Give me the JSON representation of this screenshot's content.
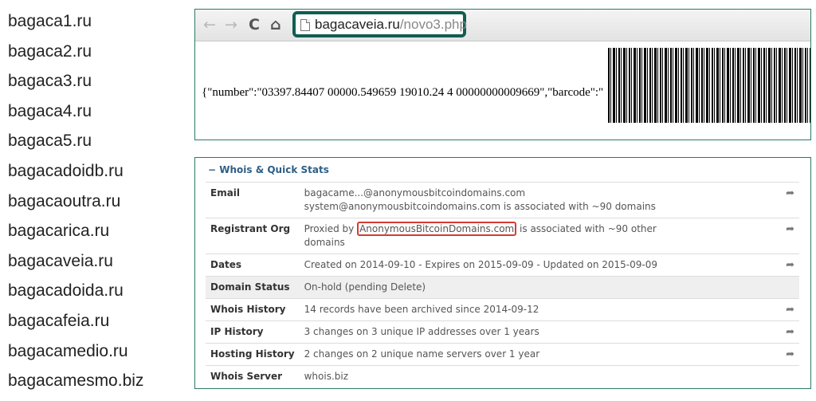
{
  "domains": [
    "bagaca1.ru",
    "bagaca2.ru",
    "bagaca3.ru",
    "bagaca4.ru",
    "bagaca5.ru",
    "bagacadoidb.ru",
    "bagacaoutra.ru",
    "bagacarica.ru",
    "bagacaveia.ru",
    "bagacadoida.ru",
    "bagacafeia.ru",
    "bagacamedio.ru",
    "bagacamesmo.biz"
  ],
  "browser": {
    "back_icon": "←",
    "forward_icon": "→",
    "reload_icon": "C",
    "home_icon": "⌂",
    "url_host": "bagacaveia.ru",
    "url_path": "/novo3.php",
    "content": "{\"number\":\"03397.84407 00000.549659 19010.24 4 00000000009669\",\"barcode\":\""
  },
  "whois": {
    "title": "Whois & Quick Stats",
    "rows": [
      {
        "key": "Email",
        "line1": "bagacame...@anonymousbitcoindomains.com",
        "line2": "system@anonymousbitcoindomains.com is associated with ~90 domains"
      },
      {
        "key": "Registrant Org",
        "pre": "Proxied by ",
        "highlight": "AnonymousBitcoinDomains.com",
        "post": " is associated with ~90 other",
        "line2": "domains"
      },
      {
        "key": "Dates",
        "value": "Created on 2014-09-10 - Expires on 2015-09-09 - Updated on 2015-09-09"
      },
      {
        "key": "Domain Status",
        "value": "On-hold (pending Delete)"
      },
      {
        "key": "Whois History",
        "value": "14 records have been archived since 2014-09-12"
      },
      {
        "key": "IP History",
        "value": "3 changes on 3 unique IP addresses over 1 years"
      },
      {
        "key": "Hosting History",
        "value": "2 changes on 2 unique name servers over 1 year"
      },
      {
        "key": "Whois Server",
        "value": "whois.biz"
      }
    ],
    "share_icon": "➦",
    "collapse_icon": "−"
  },
  "colors": {
    "panel_border": "#2b7a67",
    "url_highlight": "#0f5e51",
    "org_highlight": "#d43b34",
    "header_text": "#2e5f86"
  }
}
